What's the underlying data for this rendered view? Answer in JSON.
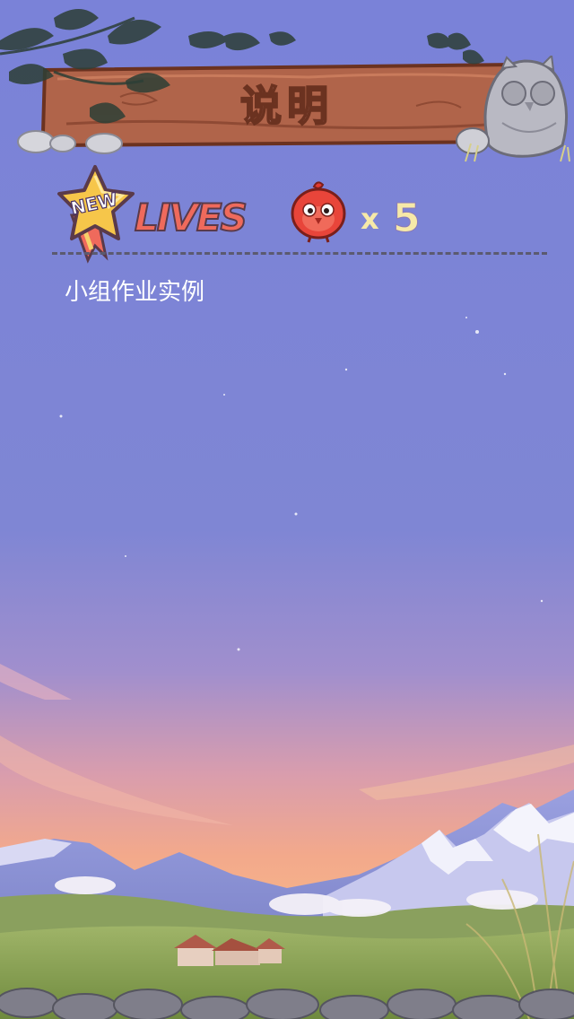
{
  "screen": {
    "title": "说明",
    "badge_text": "NEW",
    "lives_label": "LIVES",
    "lives_multiplier": "x",
    "lives_count": "5",
    "description": "小组作业实例"
  },
  "icons": {
    "badge": "new-star-ribbon-icon",
    "bird": "red-bird-icon",
    "owl": "stone-owl-icon"
  },
  "colors": {
    "sky_top": "#7b82d6",
    "sky_bottom": "#f0a67e",
    "title_fill": "#f3b7b3",
    "lives_label": "#ef6a5c",
    "count_text": "#f6e9a8"
  }
}
